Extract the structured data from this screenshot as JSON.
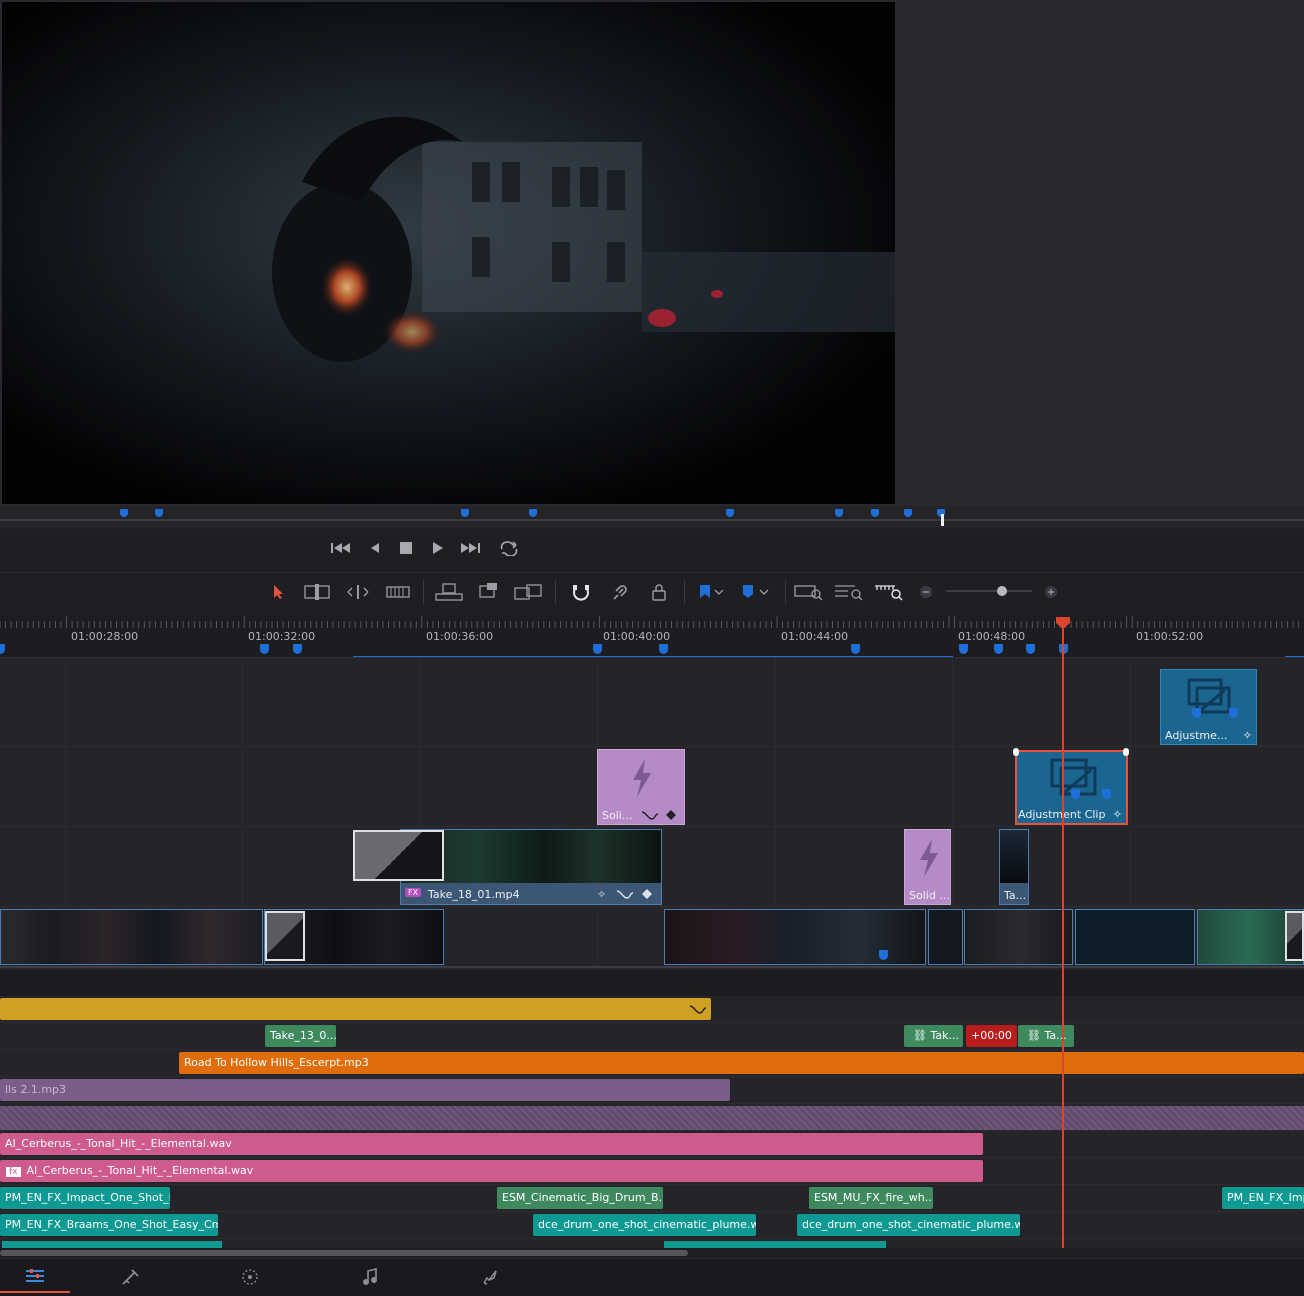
{
  "viewer": {
    "markers_label": "clip markers"
  },
  "transport": {
    "icons": [
      "skip-to-start-icon",
      "step-back-icon",
      "stop-icon",
      "play-icon",
      "skip-to-end-icon",
      "loop-icon"
    ]
  },
  "toolbar": {
    "icons": [
      "selection-arrow-icon",
      "trim-edit-icon",
      "dynamic-trim-icon",
      "blade-icon",
      "insert-clip-icon",
      "overwrite-clip-icon",
      "replace-clip-icon",
      "snapping-icon",
      "linked-selection-icon",
      "position-lock-icon",
      "flag-icon",
      "marker-icon",
      "full-zoom-icon",
      "detail-zoom-icon",
      "custom-zoom-icon",
      "zoom-out-icon",
      "zoom-in-icon"
    ],
    "zoom_level": 0.75,
    "accent": "#e8533d"
  },
  "ruler": {
    "timecodes": [
      "01:00:28:00",
      "01:00:32:00",
      "01:00:36:00",
      "01:00:40:00",
      "01:00:44:00",
      "01:00:48:00",
      "01:00:52:00"
    ]
  },
  "clips": {
    "v4_adjustment": "Adjustme...",
    "v3_solid": "Soli...",
    "v3_adjustment": "Adjustment Clip",
    "v2_take": "Take_18_01.mp4",
    "v2_fx_badge": "FX",
    "v2_solid": "Solid ...",
    "v2_take_short": "Ta..."
  },
  "audio": {
    "a1_take": "Take_13_0...",
    "a1_tak": "Tak...",
    "a1_offset": "+00:00",
    "a1_ta": "Ta...",
    "music": "Road To Hollow Hills_Escerpt.mp3",
    "music_left": "lls 2.1.mp3",
    "cerberus_1": "AI_Cerberus_-_Tonal_Hit_-_Elemental.wav",
    "cerberus_2": "AI_Cerberus_-_Tonal_Hit_-_Elemental.wav",
    "fx_badge": "fx",
    "impact": "PM_EN_FX_Impact_One_Shot_Pe...",
    "drum_big": "ESM_Cinematic_Big_Drum_B...",
    "fire": "ESM_MU_FX_fire_wh...",
    "impact_right": "PM_EN_FX_Imp",
    "braams": "PM_EN_FX_Braams_One_Shot_Easy_Cm...",
    "plume_1": "dce_drum_one_shot_cinematic_plume.w...",
    "plume_2": "dce_drum_one_shot_cinematic_plume.w..."
  },
  "colors": {
    "orange": "#e06c0c",
    "gold": "#d0a024",
    "pink": "#cf5a8e",
    "teal": "#0e9a92",
    "green": "#3e8a5e",
    "purple": "#7a5d88",
    "adjustment_blue": "#1b6591",
    "playhead_red": "#d8442e"
  },
  "pages": [
    "edit-page-icon",
    "fusion-page-icon",
    "color-page-icon",
    "fairlight-page-icon",
    "deliver-page-icon"
  ]
}
